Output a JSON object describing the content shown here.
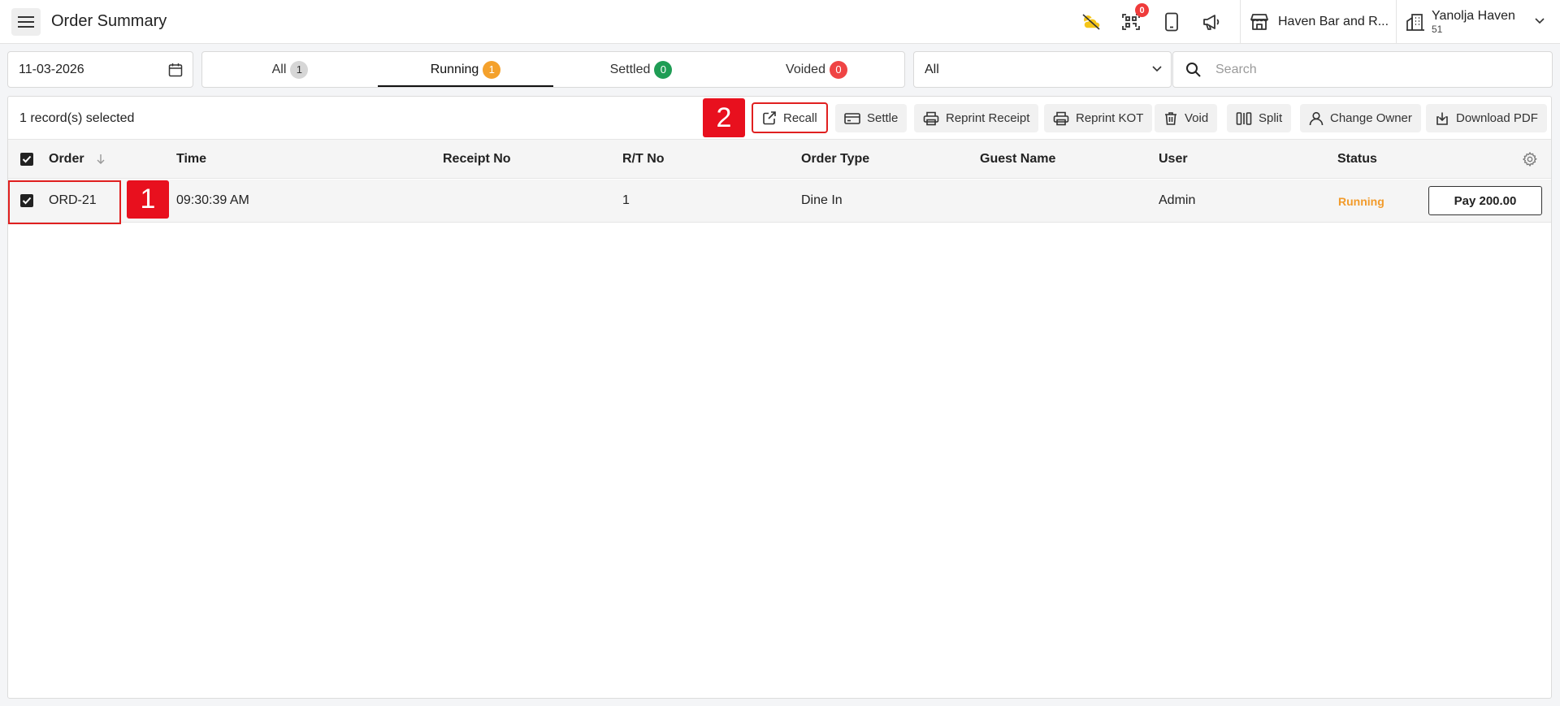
{
  "header": {
    "title": "Order Summary",
    "qr_count": "0",
    "store_name": "Haven Bar and R...",
    "account_name": "Yanolja Haven",
    "account_sub": "51"
  },
  "filters": {
    "date": "11-03-2026",
    "tabs": [
      {
        "label": "All",
        "count": "1"
      },
      {
        "label": "Running",
        "count": "1"
      },
      {
        "label": "Settled",
        "count": "0"
      },
      {
        "label": "Voided",
        "count": "0"
      }
    ],
    "active_tab": "Running",
    "type_select": "All",
    "search_placeholder": "Search"
  },
  "toolbar": {
    "selection_text": "1 record(s) selected",
    "buttons": {
      "recall": "Recall",
      "settle": "Settle",
      "reprint_receipt": "Reprint Receipt",
      "reprint_kot": "Reprint KOT",
      "void": "Void",
      "split": "Split",
      "change_owner": "Change Owner",
      "download_pdf": "Download PDF"
    }
  },
  "table": {
    "columns": [
      "Order",
      "Time",
      "Receipt No",
      "R/T No",
      "Order Type",
      "Guest Name",
      "User",
      "Status"
    ],
    "rows": [
      {
        "order": "ORD-21",
        "time": "09:30:39 AM",
        "receipt_no": "",
        "rt_no": "1",
        "order_type": "Dine In",
        "guest_name": "",
        "user": "Admin",
        "status": "Running",
        "pay_label": "Pay 200.00",
        "selected": true
      }
    ]
  },
  "annotations": {
    "step1": "1",
    "step2": "2"
  },
  "colors": {
    "accent_red": "#e8101e",
    "running_orange": "#f29b2b",
    "settled_green": "#1f9d55",
    "voided_red": "#ef4444",
    "weather_yellow": "#f5c518"
  },
  "icons": {
    "menu": "hamburger-icon",
    "weather": "cloud-sun-icon",
    "qr": "qr-code-icon",
    "device": "tablet-icon",
    "announcement": "megaphone-icon",
    "store": "storefront-icon",
    "account": "building-icon"
  }
}
